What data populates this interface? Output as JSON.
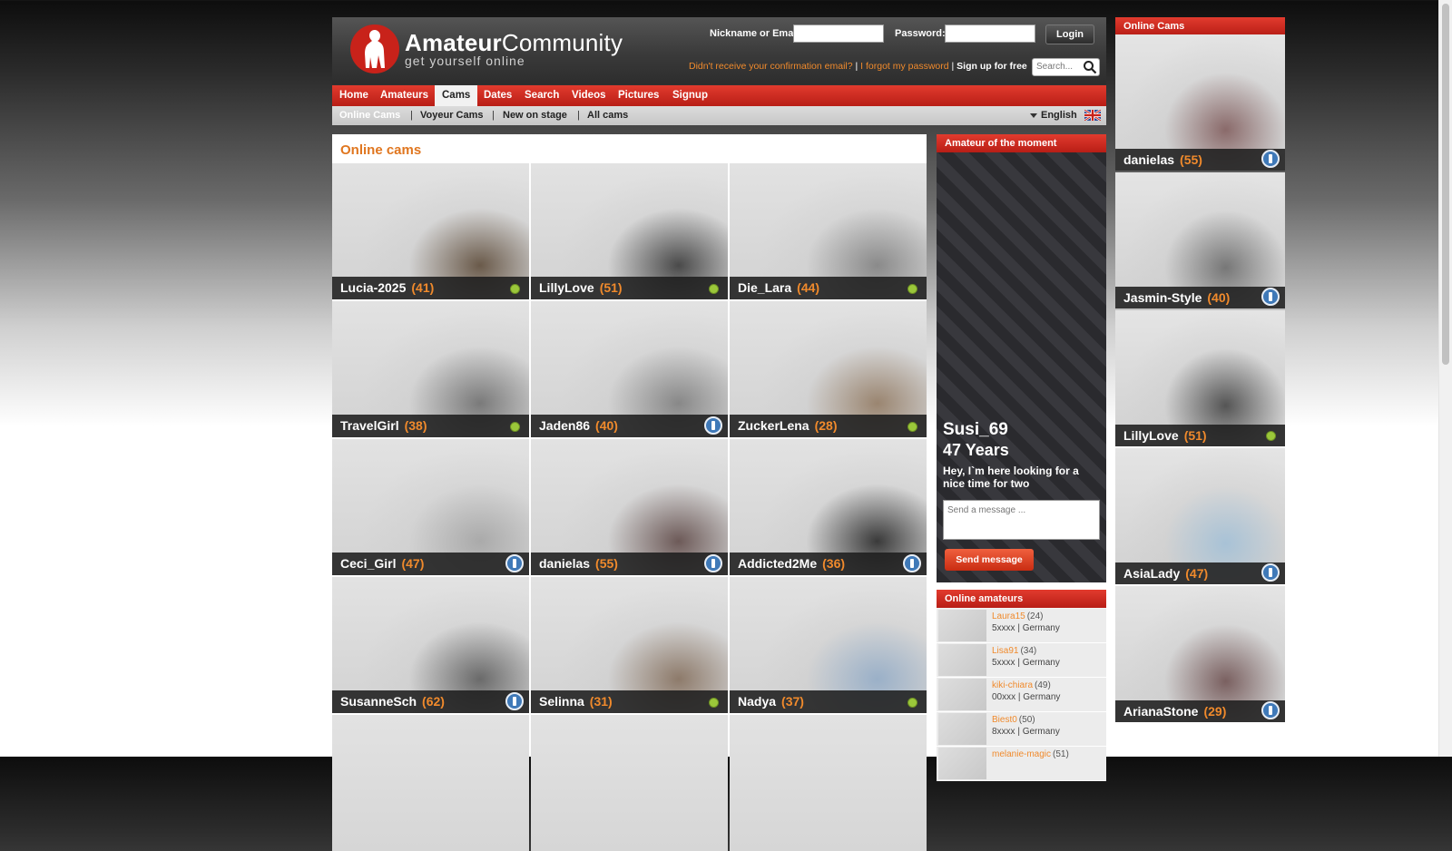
{
  "header": {
    "brand_bold": "Amateur",
    "brand_light": "Community",
    "tagline": "get yourself online",
    "nickname_label": "Nickname or Email:",
    "password_label": "Password:",
    "login_button": "Login",
    "confirm_link": "Didn't receive your confirmation email?",
    "forgot_link": "I forgot my password",
    "signup_link": "Sign up for free",
    "search_placeholder": "Search..."
  },
  "nav": {
    "items": [
      "Home",
      "Amateurs",
      "Cams",
      "Dates",
      "Search",
      "Videos",
      "Pictures",
      "Signup"
    ],
    "active": "Cams"
  },
  "subnav": {
    "items": [
      "Online Cams",
      "Voyeur Cams",
      "New on stage",
      "All cams"
    ],
    "language": "English"
  },
  "main": {
    "title": "Online cams",
    "cams": [
      {
        "name": "Lucia-2025",
        "age": "(41)",
        "status": "online"
      },
      {
        "name": "LillyLove",
        "age": "(51)",
        "status": "online"
      },
      {
        "name": "Die_Lara",
        "age": "(44)",
        "status": "online"
      },
      {
        "name": "TravelGirl",
        "age": "(38)",
        "status": "online"
      },
      {
        "name": "Jaden86",
        "age": "(40)",
        "status": "info"
      },
      {
        "name": "ZuckerLena",
        "age": "(28)",
        "status": "online"
      },
      {
        "name": "Ceci_Girl",
        "age": "(47)",
        "status": "info"
      },
      {
        "name": "danielas",
        "age": "(55)",
        "status": "info"
      },
      {
        "name": "Addicted2Me",
        "age": "(36)",
        "status": "info"
      },
      {
        "name": "SusanneSch",
        "age": "(62)",
        "status": "info"
      },
      {
        "name": "Selinna",
        "age": "(31)",
        "status": "online"
      },
      {
        "name": "Nadya",
        "age": "(37)",
        "status": "online"
      }
    ]
  },
  "moment": {
    "title": "Amateur of the moment",
    "name": "Susi_69",
    "age": "47 Years",
    "text": "Hey, I`m here looking for a nice time for two",
    "message_placeholder": "Send a message ...",
    "send_button": "Send message"
  },
  "online_amateurs": {
    "title": "Online amateurs",
    "items": [
      {
        "name": "Laura15",
        "age": "(24)",
        "location": "5xxxx | Germany"
      },
      {
        "name": "Lisa91",
        "age": "(34)",
        "location": "5xxxx | Germany"
      },
      {
        "name": "kiki-chiara",
        "age": "(49)",
        "location": "00xxx | Germany"
      },
      {
        "name": "Biest0",
        "age": "(50)",
        "location": "8xxxx | Germany"
      },
      {
        "name": "melanie-magic",
        "age": "(51)",
        "location": ""
      }
    ]
  },
  "sidebar": {
    "title": "Online Cams",
    "cams": [
      {
        "name": "danielas",
        "age": "(55)",
        "status": "info"
      },
      {
        "name": "Jasmin-Style",
        "age": "(40)",
        "status": "info"
      },
      {
        "name": "LillyLove",
        "age": "(51)",
        "status": "online"
      },
      {
        "name": "AsiaLady",
        "age": "(47)",
        "status": "info"
      },
      {
        "name": "ArianaStone",
        "age": "(29)",
        "status": "info"
      }
    ]
  },
  "colors": {
    "accent_red": "#c8221a",
    "orange": "#f08a2c",
    "online_green": "#9bc73a",
    "info_blue": "#3f79b8"
  }
}
